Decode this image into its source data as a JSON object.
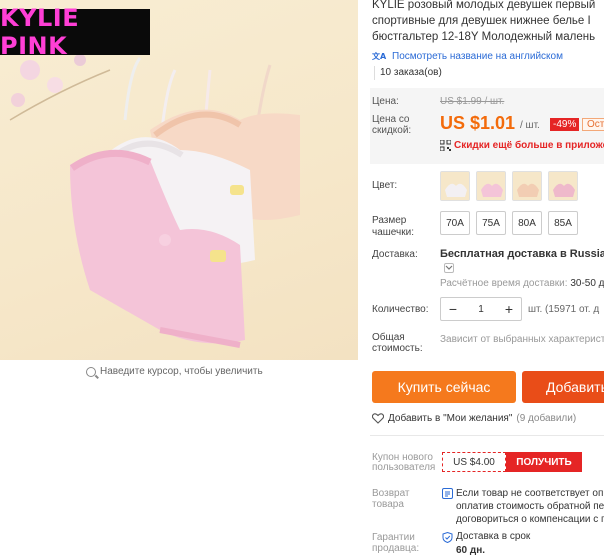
{
  "gallery": {
    "brand_badge": "KYLIE PINK",
    "zoom_hint": "Наведите курсор, чтобы увеличить"
  },
  "product": {
    "title_lines": [
      "KYLIE розовый молодых девушек первый",
      "спортивные для девушек нижнее белье I",
      "бюстгальтер 12-18Y Молодежный малень"
    ],
    "translate_link": "Посмотреть название на английском",
    "orders": "10 заказа(ов)"
  },
  "price": {
    "price_label": "Цена:",
    "old_price": "US $1.99 / шт.",
    "discount_label_1": "Цена со",
    "discount_label_2": "скидкой:",
    "new_price": "US $1.01",
    "unit": "/ шт.",
    "discount": "-49%",
    "tag": "Ост",
    "app_promo": "Скидки ещё больше в приложен"
  },
  "options": {
    "color_label": "Цвет:",
    "size_label_1": "Размер",
    "size_label_2": "чашечки:",
    "sizes": [
      "70A",
      "75A",
      "80A",
      "85A"
    ]
  },
  "shipping": {
    "label": "Доставка:",
    "title": "Бесплатная доставка в Russian Fe",
    "time_label": "Расчётное время доставки:",
    "time_value": "30-50 д"
  },
  "quantity": {
    "label": "Количество:",
    "minus": "−",
    "value": "1",
    "plus": "+",
    "note": "шт. (15971 от. д"
  },
  "total": {
    "label_1": "Общая",
    "label_2": "стоимость:",
    "note": "Зависит от выбранных характеристи"
  },
  "actions": {
    "buy": "Купить сейчас",
    "cart": "Добавить"
  },
  "wishlist": {
    "label": "Добавить в \"Мои желания\"",
    "count": "(9 добавили)"
  },
  "coupon": {
    "label_1": "Купон нового",
    "label_2": "пользователя",
    "amount": "US $4.00",
    "get": "ПОЛУЧИТЬ"
  },
  "returns": {
    "label_1": "Возврат",
    "label_2": "товара",
    "lines": [
      "Если товар не соответствует опи",
      "оплатив стоимость обратной пе",
      "договориться о компенсации с п"
    ]
  },
  "guarantee": {
    "label_1": "Гарантии",
    "label_2": "продавца:",
    "text": "Доставка в срок",
    "days": "60 дн."
  },
  "colors": {
    "price": "#f36b0b",
    "badge_text": "#ff3fd6",
    "buy": "#f5791d",
    "cart": "#e94d18",
    "accent_red": "#e52525",
    "link": "#2b6bd6"
  }
}
